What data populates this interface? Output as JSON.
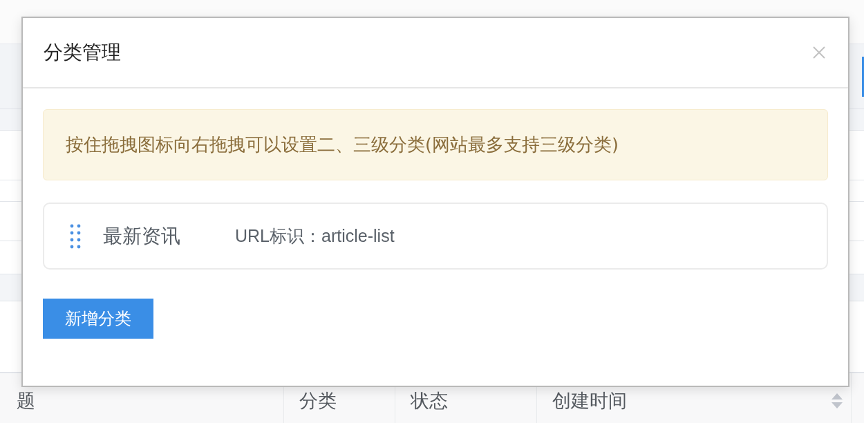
{
  "background": {
    "table_columns": [
      {
        "label": "题",
        "sortable": false
      },
      {
        "label": "分类",
        "sortable": false
      },
      {
        "label": "状态",
        "sortable": false
      },
      {
        "label": "创建时间",
        "sortable": true
      }
    ]
  },
  "dialog": {
    "title": "分类管理",
    "notice": "按住拖拽图标向右拖拽可以设置二、三级分类(网站最多支持三级分类)",
    "categories": [
      {
        "name": "最新资讯",
        "url_label": "URL标识：article-list"
      }
    ],
    "add_button": "新增分类"
  }
}
